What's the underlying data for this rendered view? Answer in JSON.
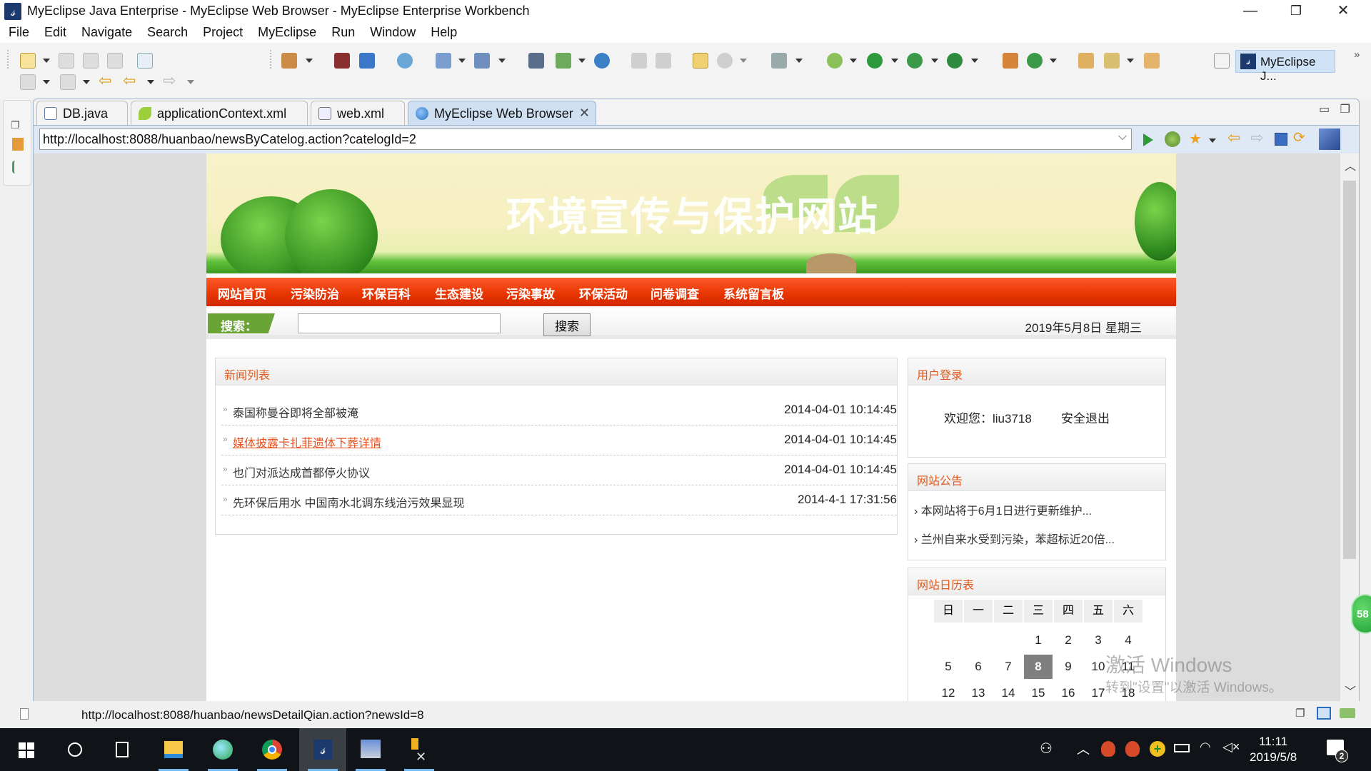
{
  "window": {
    "title": "MyEclipse Java Enterprise - MyEclipse Web Browser - MyEclipse Enterprise Workbench",
    "minimize": "—",
    "restore": "❐",
    "close": "✕"
  },
  "menu": [
    "File",
    "Edit",
    "Navigate",
    "Search",
    "Project",
    "MyEclipse",
    "Run",
    "Window",
    "Help"
  ],
  "perspective": {
    "label": "MyEclipse J...",
    "more": "»"
  },
  "editor_tabs": [
    {
      "label": "DB.java",
      "icon": "java-file-icon"
    },
    {
      "label": "applicationContext.xml",
      "icon": "spring-leaf-icon"
    },
    {
      "label": "web.xml",
      "icon": "xml-file-icon"
    },
    {
      "label": "MyEclipse Web Browser",
      "icon": "globe-icon",
      "active": true,
      "close": "✕"
    }
  ],
  "browser": {
    "url": "http://localhost:8088/huanbao/newsByCatelog.action?catelogId=2",
    "status_url": "http://localhost:8088/huanbao/newsDetailQian.action?newsId=8"
  },
  "site": {
    "banner_title": "环境宣传与保护网站",
    "nav": [
      "网站首页",
      "污染防治",
      "环保百科",
      "生态建设",
      "污染事故",
      "环保活动",
      "问卷调查",
      "系统留言板"
    ],
    "search_label": "搜索：",
    "search_value": "",
    "search_button": "搜索",
    "date_text": "2019年5月8日 星期三",
    "news_panel": {
      "title": "新闻列表",
      "items": [
        {
          "title": "泰国称曼谷即将全部被淹",
          "date": "2014-04-01 10:14:45"
        },
        {
          "title": "媒体披露卡扎菲遗体下葬详情",
          "date": "2014-04-01 10:14:45",
          "hovered": true
        },
        {
          "title": "也门对派达成首都停火协议",
          "date": "2014-04-01 10:14:45"
        },
        {
          "title": "先环保后用水 中国南水北调东线治污效果显现",
          "date": "2014-4-1 17:31:56"
        }
      ]
    },
    "login_panel": {
      "title": "用户登录",
      "welcome": "欢迎您：liu3718",
      "logout": "安全退出"
    },
    "notice_panel": {
      "title": "网站公告",
      "items": [
        "本网站将于6月1日进行更新维护...",
        "兰州自来水受到污染，苯超标近20倍..."
      ]
    },
    "calendar_panel": {
      "title": "网站日历表",
      "weekdays": [
        "日",
        "一",
        "二",
        "三",
        "四",
        "五",
        "六"
      ],
      "weeks": [
        [
          "",
          "",
          "",
          "1",
          "2",
          "3",
          "4"
        ],
        [
          "5",
          "6",
          "7",
          "8",
          "9",
          "10",
          "11"
        ],
        [
          "12",
          "13",
          "14",
          "15",
          "16",
          "17",
          "18"
        ]
      ],
      "today": "8"
    }
  },
  "floating_badge": "58",
  "watermark": {
    "line1": "激活 Windows",
    "line2": "转到\"设置\"以激活 Windows。"
  },
  "taskbar": {
    "apps": [
      "start",
      "cortana",
      "task-view",
      "file-explorer",
      "browser-360",
      "chrome",
      "myeclipse",
      "remote-desktop",
      "tools"
    ],
    "time": "11:11",
    "date": "2019/5/8",
    "notifications": "2"
  }
}
